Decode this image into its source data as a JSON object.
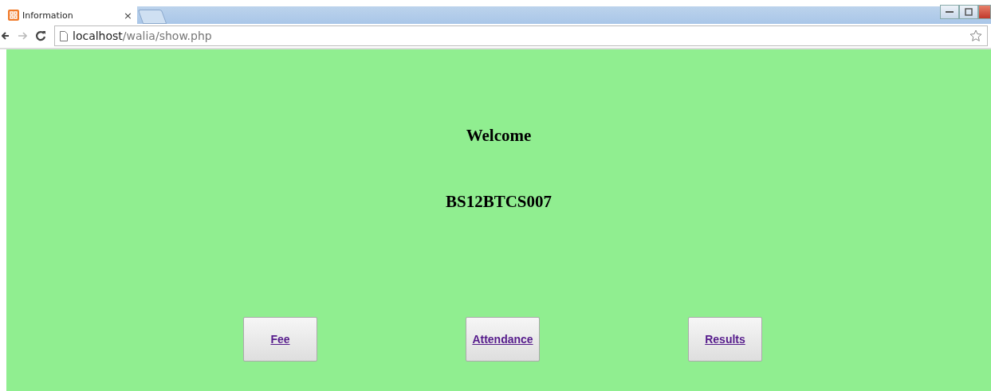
{
  "browser": {
    "tab": {
      "title": "Information",
      "close": "×"
    },
    "address": {
      "host": "localhost",
      "path": "/walia/show.php"
    }
  },
  "page": {
    "heading": "Welcome",
    "student_id": "BS12BTCS007",
    "links": [
      {
        "label": "Fee"
      },
      {
        "label": "Attendance"
      },
      {
        "label": "Results"
      }
    ]
  }
}
